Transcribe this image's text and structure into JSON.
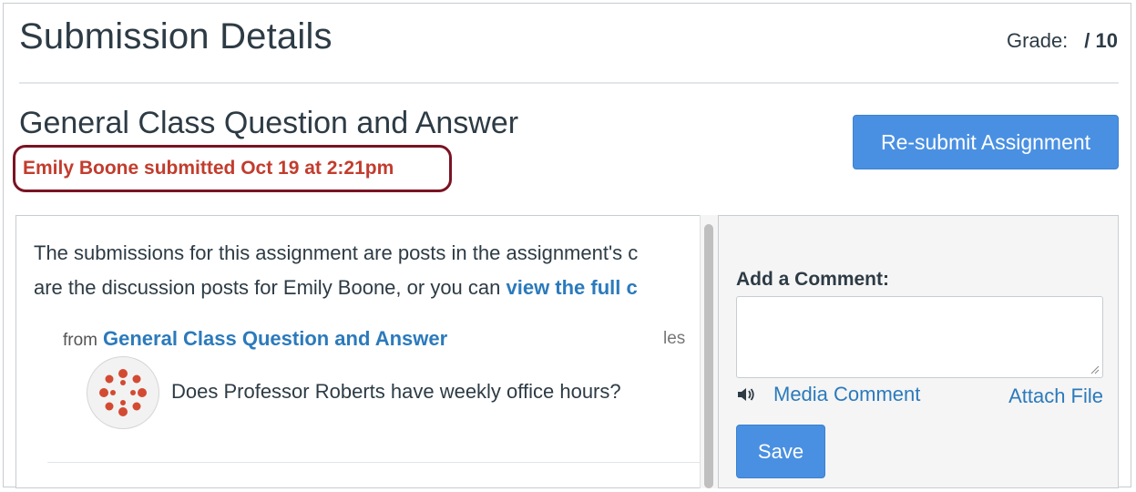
{
  "header": {
    "title": "Submission Details",
    "grade_label": "Grade:",
    "grade_value": "/ 10"
  },
  "assignment": {
    "title": "General Class Question and Answer",
    "submitted_text": "Emily Boone submitted Oct 19 at 2:21pm",
    "resubmit_label": "Re-submit Assignment"
  },
  "content": {
    "intro_line1": "The submissions for this assignment are posts in the assignment's c",
    "intro_line2": "are the discussion posts for Emily Boone, or you can ",
    "intro_link": "view the full c",
    "from_label": "from",
    "from_link": "General Class Question and Answer",
    "cut_text": "les",
    "post_text": "Does Professor Roberts have weekly office hours?"
  },
  "comment": {
    "label": "Add a Comment:",
    "input_value": "",
    "media_label": "Media Comment",
    "attach_label": "Attach File",
    "save_label": "Save"
  },
  "icons": {
    "speaker": "speaker-icon",
    "avatar": "canvas-logo-avatar"
  },
  "colors": {
    "primary_button": "#4a90e2",
    "link": "#2b7abc",
    "submitted_text": "#c23c2d",
    "highlight_border": "#7a1323"
  }
}
